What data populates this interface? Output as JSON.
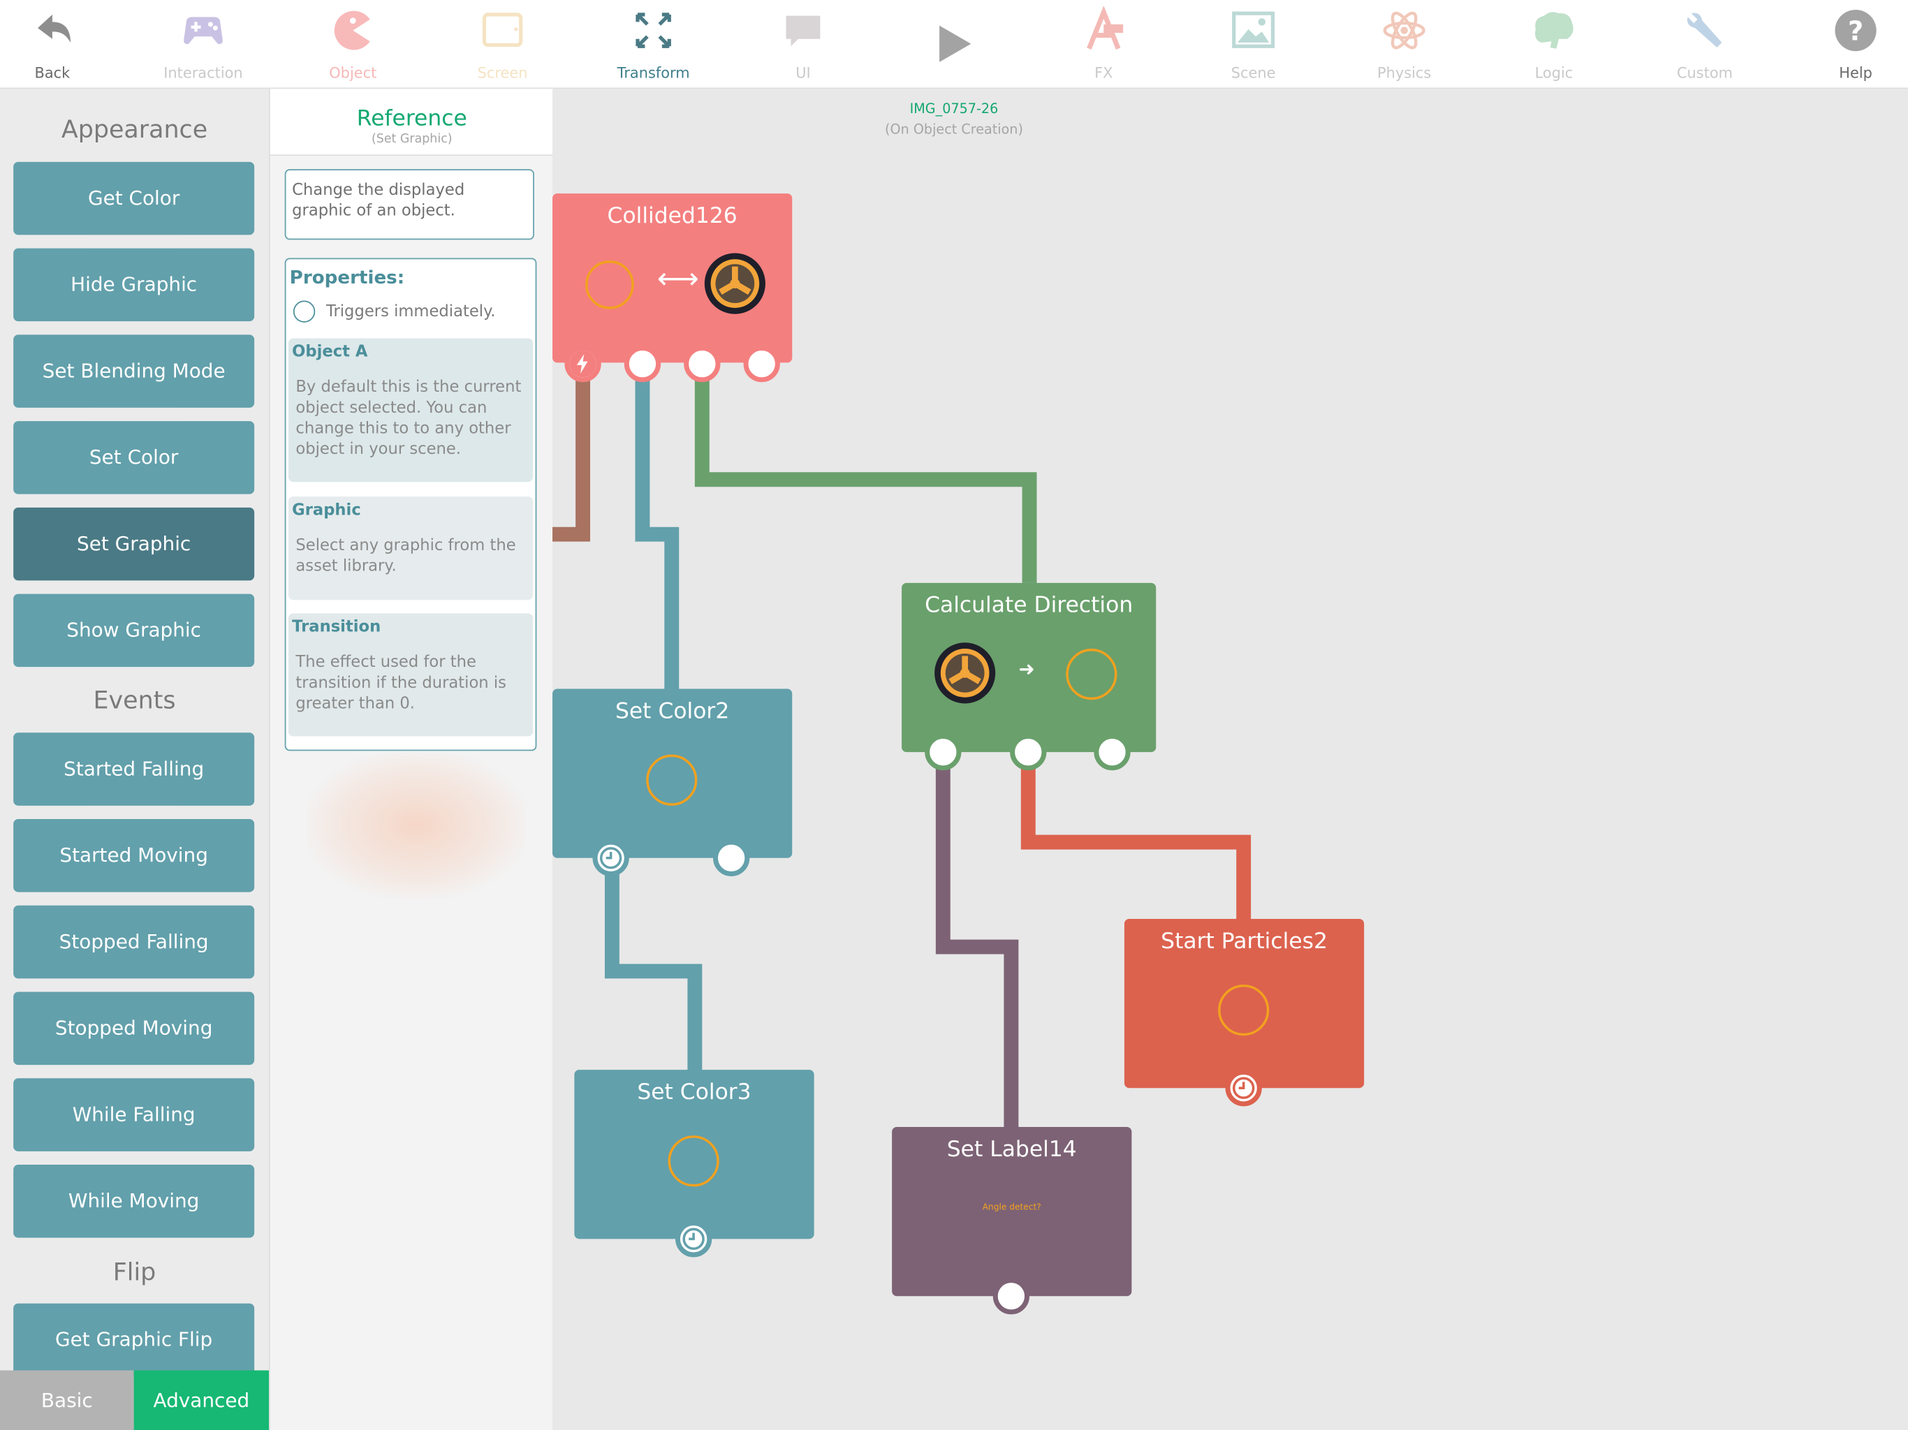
{
  "toolbar": {
    "items": [
      {
        "label": "Back",
        "icon": "back-arrow-icon"
      },
      {
        "label": "Interaction",
        "icon": "gamepad-icon"
      },
      {
        "label": "Object",
        "icon": "pacman-icon"
      },
      {
        "label": "Screen",
        "icon": "screen-icon"
      },
      {
        "label": "Transform",
        "icon": "transform-arrows-icon"
      },
      {
        "label": "UI",
        "icon": "speech-bubble-icon"
      },
      {
        "label": "",
        "icon": "play-icon"
      },
      {
        "label": "FX",
        "icon": "fx-letter-icon"
      },
      {
        "label": "Scene",
        "icon": "image-icon"
      },
      {
        "label": "Physics",
        "icon": "atom-icon"
      },
      {
        "label": "Logic",
        "icon": "brain-icon"
      },
      {
        "label": "Custom",
        "icon": "wrench-icon"
      },
      {
        "label": "Help",
        "icon": "help-icon"
      }
    ]
  },
  "sidebar": {
    "sections": [
      "Appearance",
      "Events",
      "Flip"
    ],
    "appearance": [
      "Get Color",
      "Hide Graphic",
      "Set Blending Mode",
      "Set Color",
      "Set Graphic",
      "Show Graphic"
    ],
    "events": [
      "Started Falling",
      "Started Moving",
      "Stopped Falling",
      "Stopped Moving",
      "While Falling",
      "While Moving"
    ],
    "flip": [
      "Get Graphic Flip"
    ],
    "mode": {
      "basic": "Basic",
      "advanced": "Advanced"
    }
  },
  "reference": {
    "title": "Reference",
    "subtitle": "(Set Graphic)",
    "description": "Change the displayed graphic of an object.",
    "properties_title": "Properties:",
    "trigger_text": "Triggers immediately.",
    "properties": [
      {
        "name": "Object A",
        "text": "By default this is the current object selected. You can change this to to any other object in your scene."
      },
      {
        "name": "Graphic",
        "text": "Select any graphic from the asset library."
      },
      {
        "name": "Transition",
        "text": "The effect used for the transition if the duration is greater than 0."
      }
    ]
  },
  "canvas": {
    "scene_name": "IMG_0757-26",
    "scene_event": "(On Object Creation)",
    "nodes": {
      "collided": {
        "title": "Collided126"
      },
      "calc": {
        "title": "Calculate Direction"
      },
      "setcolor2": {
        "title": "Set Color2"
      },
      "setcolor3": {
        "title": "Set Color3"
      },
      "particles": {
        "title": "Start Particles2"
      },
      "label": {
        "title": "Set Label14",
        "text": "Angle detect?"
      }
    }
  },
  "colors": {
    "accent_green": "#16b873",
    "teal": "#62a0ab",
    "teal_dark": "#4a7a85",
    "collided_node": "#f47f7f",
    "calc_node": "#6aa06c",
    "particles_node": "#dc624e",
    "label_node": "#7d6275",
    "ring_orange": "#f2a11e"
  }
}
